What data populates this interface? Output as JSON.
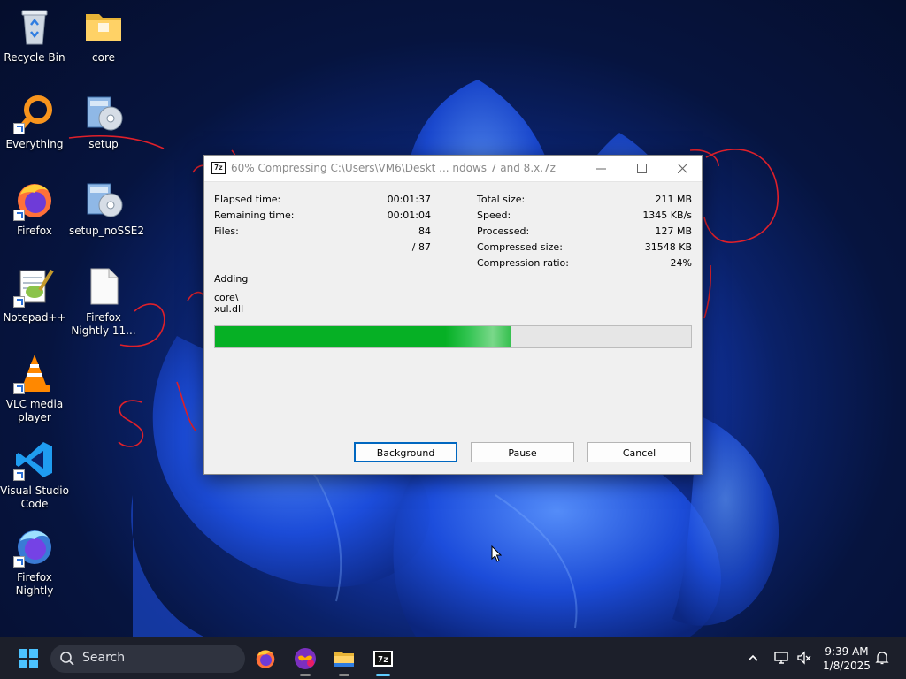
{
  "desktop": {
    "icons": [
      {
        "label": "Recycle Bin",
        "icon": "recycle-bin-icon"
      },
      {
        "label": "core",
        "icon": "folder-icon"
      },
      {
        "label": "Everything",
        "icon": "everything-icon"
      },
      {
        "label": "setup",
        "icon": "installer-icon"
      },
      {
        "label": "Firefox",
        "icon": "firefox-icon"
      },
      {
        "label": "setup_noSSE2",
        "icon": "installer-icon"
      },
      {
        "label": "Notepad++",
        "icon": "notepadpp-icon"
      },
      {
        "label": "Firefox Nightly 11...",
        "icon": "file-icon"
      },
      {
        "label": "VLC media player",
        "icon": "vlc-icon"
      },
      {
        "label": "Visual Studio Code",
        "icon": "vscode-icon"
      },
      {
        "label": "Firefox Nightly",
        "icon": "firefox-nightly-icon"
      }
    ]
  },
  "dialog": {
    "app_icon_text": "7z",
    "title": "60% Compressing C:\\Users\\VM6\\Deskt ... ndows 7 and 8.x.7z",
    "left_stats": [
      {
        "label": "Elapsed time:",
        "value": "00:01:37"
      },
      {
        "label": "Remaining time:",
        "value": "00:01:04"
      },
      {
        "label": "Files:",
        "value": "84"
      },
      {
        "label": "",
        "value": "/ 87"
      }
    ],
    "right_stats": [
      {
        "label": "Total size:",
        "value": "211 MB"
      },
      {
        "label": "Speed:",
        "value": "1345 KB/s"
      },
      {
        "label": "Processed:",
        "value": "127 MB"
      },
      {
        "label": "Compressed size:",
        "value": "31548 KB"
      },
      {
        "label": "Compression ratio:",
        "value": "24%"
      }
    ],
    "status": "Adding",
    "current_path": "core\\",
    "current_file": "xul.dll",
    "progress": 0.62,
    "buttons": {
      "background": "Background",
      "pause": "Pause",
      "cancel": "Cancel"
    }
  },
  "taskbar": {
    "search_label": "Search",
    "time": "9:39 AM",
    "date": "1/8/2025",
    "pinned": [
      "firefox-icon",
      "mask-icon",
      "file-explorer-icon",
      "7zip-icon"
    ]
  },
  "colors": {
    "progress_green": "#06b025",
    "annotation_red": "#e0202a",
    "taskbar_bg": "#1c1f2a"
  }
}
